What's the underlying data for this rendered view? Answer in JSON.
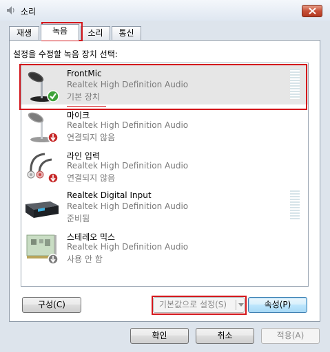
{
  "window": {
    "title": "소리"
  },
  "tabs": [
    {
      "label": "재생"
    },
    {
      "label": "녹음"
    },
    {
      "label": "소리"
    },
    {
      "label": "통신"
    }
  ],
  "instruction": "설정을 수정할 녹음 장치 선택:",
  "devices": [
    {
      "name": "FrontMic",
      "description": "Realtek High Definition Audio",
      "status": "기본 장치",
      "icon": "microphone-icon",
      "badge": "default-check-icon"
    },
    {
      "name": "마이크",
      "description": "Realtek High Definition Audio",
      "status": "연결되지 않음",
      "icon": "microphone-icon",
      "badge": "disconnected-icon"
    },
    {
      "name": "라인 입력",
      "description": "Realtek High Definition Audio",
      "status": "연결되지 않음",
      "icon": "line-in-cable-icon",
      "badge": "disconnected-icon"
    },
    {
      "name": "Realtek Digital Input",
      "description": "Realtek High Definition Audio",
      "status": "준비됨",
      "icon": "digital-input-device-icon"
    },
    {
      "name": "스테레오 믹스",
      "description": "Realtek High Definition Audio",
      "status": "사용 안 함",
      "icon": "sound-card-icon",
      "badge": "disabled-icon"
    }
  ],
  "buttons": {
    "configure": "구성(C)",
    "set_default": "기본값으로 설정(S)",
    "properties": "속성(P)",
    "ok": "확인",
    "cancel": "취소",
    "apply": "적용(A)"
  },
  "colors": {
    "highlight": "#d4161b",
    "selected_row": "#e6e6e6",
    "meter": "#d6e3e8"
  }
}
